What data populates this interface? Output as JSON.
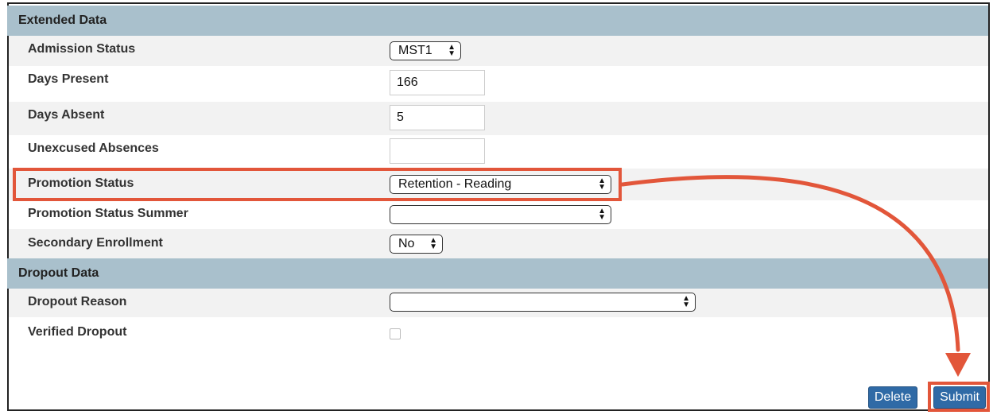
{
  "sections": {
    "extended": {
      "title": "Extended Data"
    },
    "dropout": {
      "title": "Dropout Data"
    }
  },
  "fields": {
    "admission_status": {
      "label": "Admission Status",
      "value": "MST1"
    },
    "days_present": {
      "label": "Days Present",
      "value": "166"
    },
    "days_absent": {
      "label": "Days Absent",
      "value": "5"
    },
    "unexcused_absences": {
      "label": "Unexcused Absences",
      "value": ""
    },
    "promotion_status": {
      "label": "Promotion Status",
      "value": "Retention - Reading"
    },
    "promotion_status_summer": {
      "label": "Promotion Status Summer",
      "value": ""
    },
    "secondary_enrollment": {
      "label": "Secondary Enrollment",
      "value": "No"
    },
    "dropout_reason": {
      "label": "Dropout Reason",
      "value": ""
    },
    "verified_dropout": {
      "label": "Verified Dropout",
      "checked": false
    }
  },
  "buttons": {
    "delete": "Delete",
    "submit": "Submit"
  },
  "colors": {
    "section_header": "#a9c0cc",
    "row_shade": "#f2f2f2",
    "button": "#2f6aa6",
    "annotation": "#e2563a"
  },
  "icons": {
    "select_arrows": "up-down-chevron-icon",
    "annotation_arrow": "curved-arrow-icon"
  }
}
